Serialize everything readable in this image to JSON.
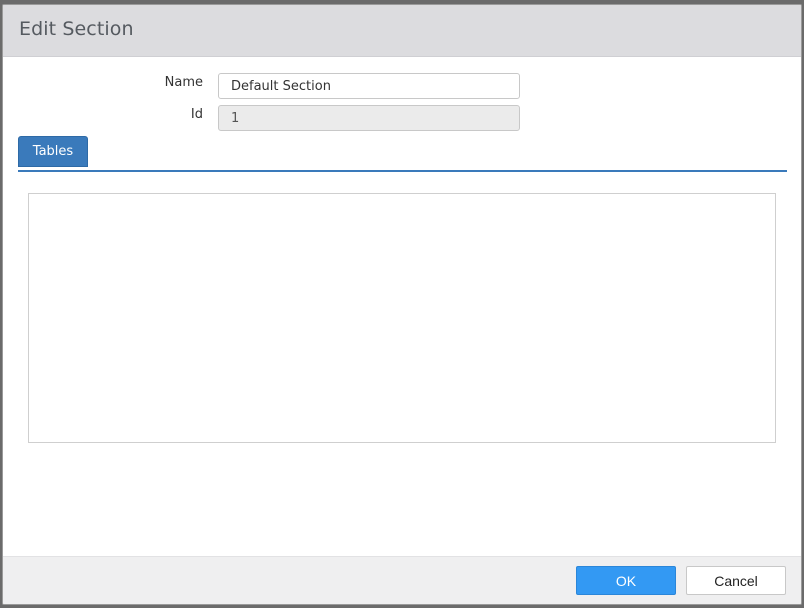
{
  "dialog": {
    "title": "Edit Section"
  },
  "form": {
    "name_label": "Name",
    "name_value": "Default Section",
    "id_label": "Id",
    "id_value": "1"
  },
  "tabs": [
    {
      "label": "Tables",
      "active": true
    }
  ],
  "footer": {
    "ok_label": "OK",
    "cancel_label": "Cancel"
  },
  "colors": {
    "accent": "#3a7abb",
    "ok_button": "#3399f3",
    "titlebar": "#dcdcdf",
    "footer": "#efeff0"
  }
}
